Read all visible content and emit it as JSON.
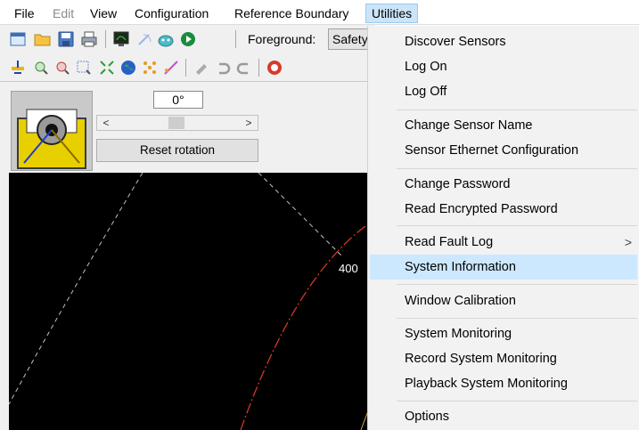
{
  "menubar": {
    "items": [
      {
        "label": "File",
        "state": "normal"
      },
      {
        "label": "Edit",
        "state": "disabled"
      },
      {
        "label": "View",
        "state": "normal"
      },
      {
        "label": "Configuration",
        "state": "normal"
      },
      {
        "label": "Reference Boundary",
        "state": "normal"
      },
      {
        "label": "Utilities",
        "state": "active"
      }
    ]
  },
  "toolbar": {
    "foreground_label": "Foreground:",
    "foreground_value": "Safety"
  },
  "view": {
    "angle": "0°",
    "scroll_left": "<",
    "scroll_right": ">",
    "reset_label": "Reset rotation",
    "range_label": "400"
  },
  "utilities_menu": {
    "items": [
      {
        "label": "Discover Sensors"
      },
      {
        "label": "Log On"
      },
      {
        "label": "Log Off"
      },
      {
        "label": "Change Sensor Name"
      },
      {
        "label": "Sensor Ethernet Configuration"
      },
      {
        "label": "Change Password"
      },
      {
        "label": "Read Encrypted Password"
      },
      {
        "label": "Read Fault Log",
        "submenu_arrow": ">"
      },
      {
        "label": "System Information",
        "highlighted": true
      },
      {
        "label": "Window Calibration"
      },
      {
        "label": "System Monitoring"
      },
      {
        "label": "Record System Monitoring"
      },
      {
        "label": "Playback System Monitoring"
      },
      {
        "label": "Options"
      }
    ]
  },
  "colors": {
    "menu_highlight": "#cce8ff",
    "menubar_active": "#cce4f7",
    "canvas_bg": "#000000",
    "boundary_red": "#e23a2a"
  }
}
